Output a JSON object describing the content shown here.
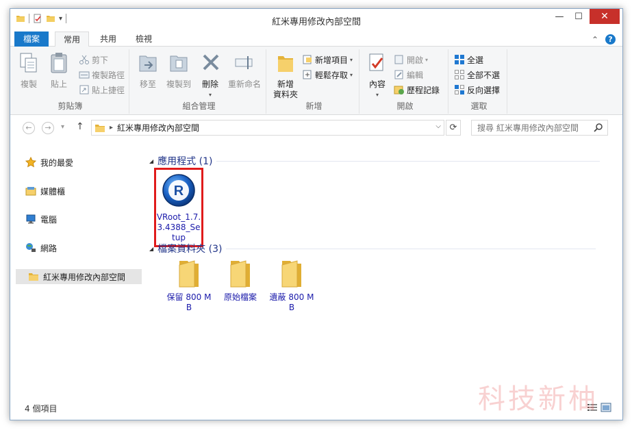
{
  "window": {
    "title": "紅米專用修改內部空間",
    "min_symbol": "—",
    "max_symbol": "☐",
    "close_symbol": "✕"
  },
  "qat": {
    "dropdown_symbol": "▾"
  },
  "tabs": {
    "file": "檔案",
    "home": "常用",
    "share": "共用",
    "view": "檢視",
    "collapse_symbol": "⌃",
    "help_symbol": "?"
  },
  "ribbon": {
    "clipboard": {
      "label": "剪貼簿",
      "copy": "複製",
      "paste": "貼上",
      "cut": "剪下",
      "copy_path": "複製路徑",
      "paste_shortcut": "貼上捷徑"
    },
    "organize": {
      "label": "組合管理",
      "move_to": "移至",
      "copy_to": "複製到",
      "delete": "刪除",
      "rename": "重新命名"
    },
    "new": {
      "label": "新增",
      "new_folder_line1": "新增",
      "new_folder_line2": "資料夾",
      "new_item": "新增項目",
      "easy_access": "輕鬆存取"
    },
    "open": {
      "label": "開啟",
      "properties": "內容",
      "open": "開啟",
      "edit": "編輯",
      "history": "歷程記錄"
    },
    "select": {
      "label": "選取",
      "select_all": "全選",
      "select_none": "全部不選",
      "invert": "反向選擇"
    }
  },
  "nav": {
    "back_symbol": "←",
    "forward_symbol": "→",
    "recent_symbol": "▾",
    "up_symbol": "↑",
    "address_chevron": "▸",
    "address_path": "紅米專用修改內部空間",
    "address_dropdown": "⌵",
    "refresh_symbol": "⟳",
    "search_placeholder": "搜尋 紅米專用修改內部空間"
  },
  "sidebar": {
    "items": [
      {
        "label": "我的最愛",
        "icon": "star-icon"
      },
      {
        "label": "媒體櫃",
        "icon": "library-icon"
      },
      {
        "label": "電腦",
        "icon": "computer-icon"
      },
      {
        "label": "網路",
        "icon": "network-icon"
      },
      {
        "label": "紅米專用修改內部空間",
        "icon": "folder-icon"
      }
    ]
  },
  "content": {
    "group_collapse_symbol": "◢",
    "groups": [
      {
        "header": "應用程式 (1)",
        "items": [
          {
            "name": "VRoot_1.7.3.4388_Setup",
            "icon": "vroot-app-icon",
            "selected": true
          }
        ]
      },
      {
        "header": "檔案資料夾 (3)",
        "items": [
          {
            "name": "保留 800 MB",
            "icon": "folder-icon"
          },
          {
            "name": "原始檔案",
            "icon": "folder-icon"
          },
          {
            "name": "遺蔽 800 MB",
            "icon": "folder-icon"
          }
        ]
      }
    ],
    "vroot_logo_letter": "R"
  },
  "status": {
    "count": "4 個項目"
  },
  "watermark": "科技新柚",
  "colors": {
    "accent": "#1979ca",
    "close": "#c7302a",
    "selection_highlight": "#e01b1b",
    "folder": "#f0c85a"
  }
}
